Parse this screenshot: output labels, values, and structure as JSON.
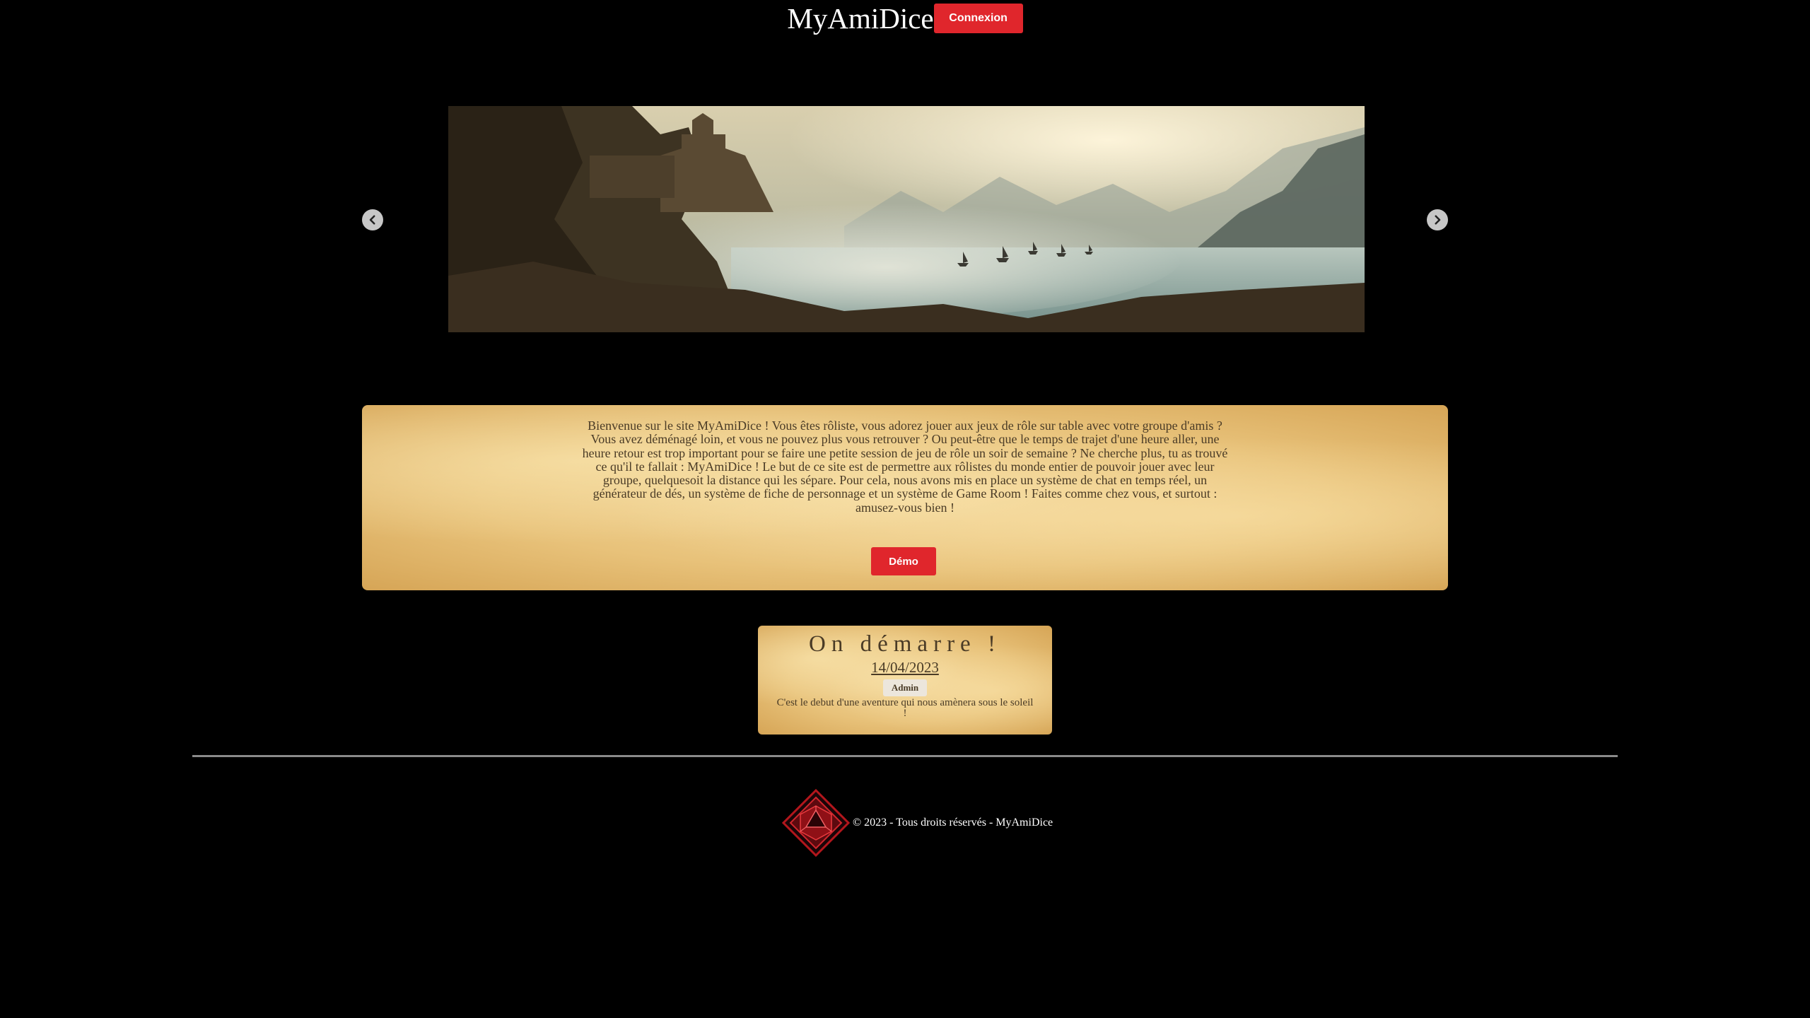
{
  "header": {
    "title": "MyAmiDice",
    "login_label": "Connexion"
  },
  "carousel": {
    "image_alt": "Paysage fantastique : cité en ruines sur une falaise et navires dans une baie brumeuse",
    "prev_icon": "chevron-left-icon",
    "next_icon": "chevron-right-icon"
  },
  "intro": {
    "text": "Bienvenue sur le site MyAmiDice ! Vous êtes rôliste, vous adorez jouer aux jeux de rôle sur table avec votre groupe d'amis ? Vous avez déménagé loin, et vous ne pouvez plus vous retrouver ? Ou peut-être que le temps de trajet d'une heure aller, une heure retour est trop important pour se faire une petite session de jeu de rôle un soir de semaine ? Ne cherche plus, tu as trouvé ce qu'il te fallait : MyAmiDice ! Le but de ce site est de permettre aux rôlistes du monde entier de pouvoir jouer avec leur groupe, quelquesoit la distance qui les sépare. Pour cela, nous avons mis en place un système de chat en temps réel, un générateur de dés, un système de fiche de personnage et un système de Game Room ! Faites comme chez vous, et surtout : amusez-vous bien !",
    "demo_label": "Démo"
  },
  "news": {
    "title": "On démarre !",
    "date": "14/04/2023",
    "author": "Admin",
    "body": "C'est le debut d'une aventure qui nous amènera sous le soleil !"
  },
  "footer": {
    "text": "© 2023 - Tous droits réservés - MyAmiDice",
    "logo_icon": "d20-dice-logo-icon"
  },
  "colors": {
    "background": "#000000",
    "accent_red": "#e0262c",
    "parchment": "#e8c27a",
    "text_brown": "#4a3b26"
  }
}
